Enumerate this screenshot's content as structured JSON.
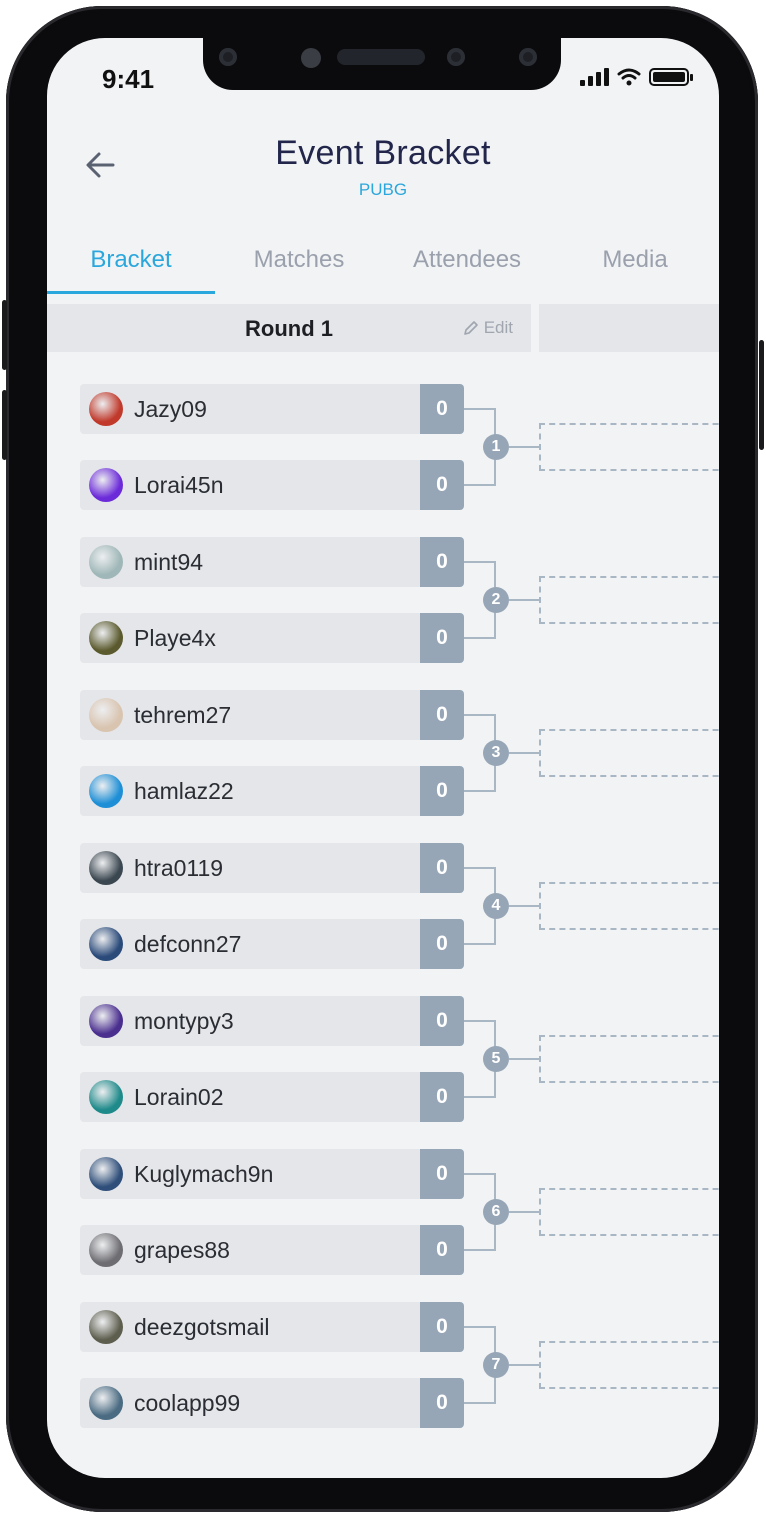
{
  "status": {
    "time": "9:41"
  },
  "header": {
    "title": "Event Bracket",
    "subtitle": "PUBG"
  },
  "tabs": [
    {
      "label": "Bracket",
      "active": true
    },
    {
      "label": "Matches",
      "active": false
    },
    {
      "label": "Attendees",
      "active": false
    },
    {
      "label": "Media",
      "active": false
    }
  ],
  "round": {
    "title": "Round 1",
    "edit_label": "Edit"
  },
  "matches": [
    {
      "number": "1",
      "players": [
        {
          "name": "Jazy09",
          "score": "0",
          "avatar_color": "#c0392b"
        },
        {
          "name": "Lorai45n",
          "score": "0",
          "avatar_color": "#6c2bd9"
        }
      ]
    },
    {
      "number": "2",
      "players": [
        {
          "name": "mint94",
          "score": "0",
          "avatar_color": "#9fb7b8"
        },
        {
          "name": "Playe4x",
          "score": "0",
          "avatar_color": "#5b5a2e"
        }
      ]
    },
    {
      "number": "3",
      "players": [
        {
          "name": "tehrem27",
          "score": "0",
          "avatar_color": "#d9c4b0"
        },
        {
          "name": "hamlaz22",
          "score": "0",
          "avatar_color": "#1e8fd6"
        }
      ]
    },
    {
      "number": "4",
      "players": [
        {
          "name": "htra0119",
          "score": "0",
          "avatar_color": "#3b4750"
        },
        {
          "name": "defconn27",
          "score": "0",
          "avatar_color": "#2a4a7a"
        }
      ]
    },
    {
      "number": "5",
      "players": [
        {
          "name": "montypy3",
          "score": "0",
          "avatar_color": "#4a2f8f"
        },
        {
          "name": "Lorain02",
          "score": "0",
          "avatar_color": "#1f8a8a"
        }
      ]
    },
    {
      "number": "6",
      "players": [
        {
          "name": "Kuglymach9n",
          "score": "0",
          "avatar_color": "#2f4f7a"
        },
        {
          "name": "grapes88",
          "score": "0",
          "avatar_color": "#6e6e72"
        }
      ]
    },
    {
      "number": "7",
      "players": [
        {
          "name": "deezgotsmail",
          "score": "0",
          "avatar_color": "#5e5e4e"
        },
        {
          "name": "coolapp99",
          "score": "0",
          "avatar_color": "#4a6b82"
        }
      ]
    }
  ]
}
